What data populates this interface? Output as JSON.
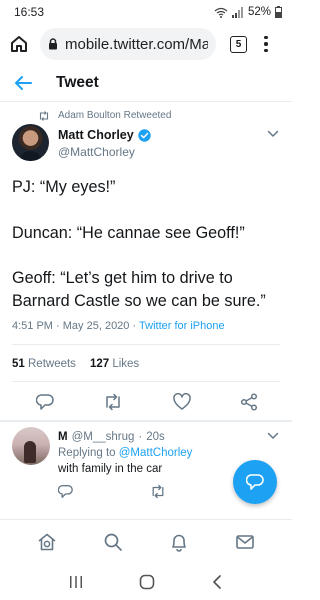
{
  "status_bar": {
    "time": "16:53",
    "battery": "52%"
  },
  "browser": {
    "url": "mobile.twitter.com/Ma",
    "tab_count": "5"
  },
  "header": {
    "title": "Tweet"
  },
  "tweet": {
    "retweet_context": "Adam Boulton Retweeted",
    "author": {
      "name": "Matt Chorley",
      "handle": "@MattChorley",
      "verified": true
    },
    "lines": [
      "PJ: “My eyes!”",
      "Duncan: “He cannae see Geoff!”",
      "Geoff: “Let’s get him to drive to Barnard Castle so we can be sure.”"
    ],
    "time": "4:51 PM",
    "separator": "·",
    "date": "May 25, 2020",
    "source": "Twitter for iPhone",
    "retweets": {
      "count": "51",
      "label": "Retweets"
    },
    "likes": {
      "count": "127",
      "label": "Likes"
    }
  },
  "reply": {
    "name": "M",
    "handle": "@M__shrug",
    "separator": "·",
    "time": "20s",
    "replying_prefix": "Replying to",
    "replying_to": "@MattChorley",
    "text": "with family in the car"
  },
  "icons": {
    "reply": "reply-icon",
    "retweet": "retweet-icon",
    "like": "like-icon",
    "share": "share-icon",
    "home": "home-icon",
    "search": "search-icon",
    "notifications": "bell-icon",
    "messages": "mail-icon",
    "compose": "compose-icon"
  },
  "colors": {
    "accent": "#1da1f2",
    "text": "#14171a",
    "muted": "#657786",
    "divider": "#e6ecf0"
  }
}
